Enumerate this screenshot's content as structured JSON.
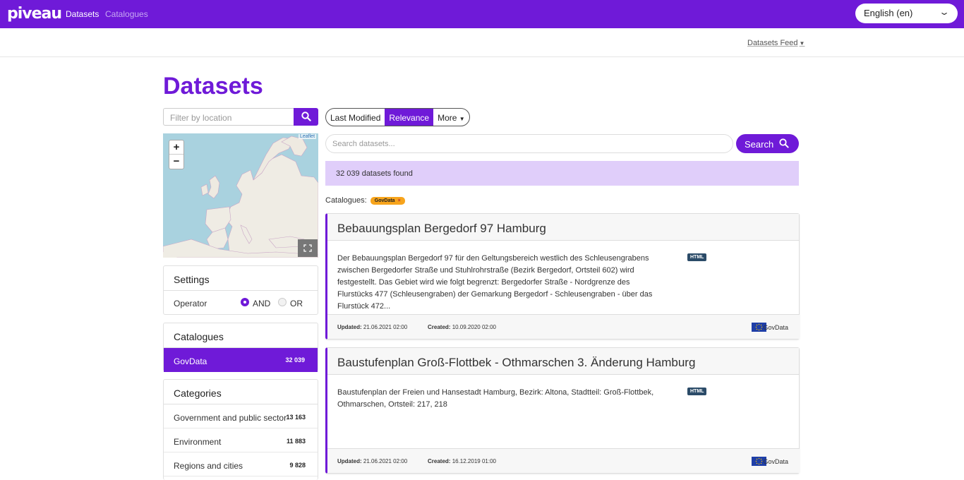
{
  "header": {
    "logo": "piveau",
    "nav": [
      "Datasets",
      "Catalogues"
    ],
    "language": "English (en)"
  },
  "subbar": {
    "feed": "Datasets Feed"
  },
  "page_title": "Datasets",
  "location_filter": {
    "placeholder": "Filter by location"
  },
  "map": {
    "attribution": "Leaflet",
    "zoom_in": "+",
    "zoom_out": "−"
  },
  "settings": {
    "title": "Settings",
    "operator_label": "Operator",
    "opt_and": "AND",
    "opt_or": "OR",
    "selected": "AND"
  },
  "catalogues": {
    "title": "Catalogues",
    "items": [
      {
        "label": "GovData",
        "count": "32 039"
      }
    ]
  },
  "categories": {
    "title": "Categories",
    "items": [
      {
        "label": "Government and public sector",
        "count": "13 163"
      },
      {
        "label": "Environment",
        "count": "11 883"
      },
      {
        "label": "Regions and cities",
        "count": "9 828"
      }
    ]
  },
  "sort": {
    "options": [
      "Last Modified",
      "Relevance",
      "More"
    ],
    "selected": "Relevance"
  },
  "search": {
    "placeholder": "Search datasets...",
    "button": "Search"
  },
  "results": {
    "found_text": "32 039 datasets found",
    "catalogue_label": "Catalogues:",
    "catalogue_pill": "GovData"
  },
  "datasets": [
    {
      "title": "Bebauungsplan Bergedorf 97 Hamburg",
      "description": "Der Bebauungsplan Bergedorf 97 für den Geltungsbereich westlich des Schleusengrabens zwischen Bergedorfer Straße und Stuhlrohrstraße (Bezirk Bergedorf, Ortsteil 602) wird festgestellt. Das Gebiet wird wie folgt begrenzt: Bergedorfer Straße - Nordgrenze des Flurstücks 477 (Schleusengraben) der Gemarkung Bergedorf - Schleusengraben - über das Flurstück 472...",
      "format": "HTML",
      "updated_label": "Updated:",
      "updated": "21.06.2021 02:00",
      "created_label": "Created:",
      "created": "10.09.2020 02:00",
      "source": "GovData"
    },
    {
      "title": "Baustufenplan Groß-Flottbek - Othmarschen 3. Änderung Hamburg",
      "description": "Baustufenplan der Freien und Hansestadt Hamburg, Bezirk: Altona, Stadtteil: Groß-Flottbek, Othmarschen, Ortsteil: 217, 218",
      "format": "HTML",
      "updated_label": "Updated:",
      "updated": "21.06.2021 02:00",
      "created_label": "Created:",
      "created": "16.12.2019 01:00",
      "source": "GovData"
    }
  ],
  "colors": {
    "brand": "#6f1ad8",
    "found_bg": "#e0cefa",
    "pill": "#f7a41c",
    "format_badge": "#2b4b68"
  }
}
